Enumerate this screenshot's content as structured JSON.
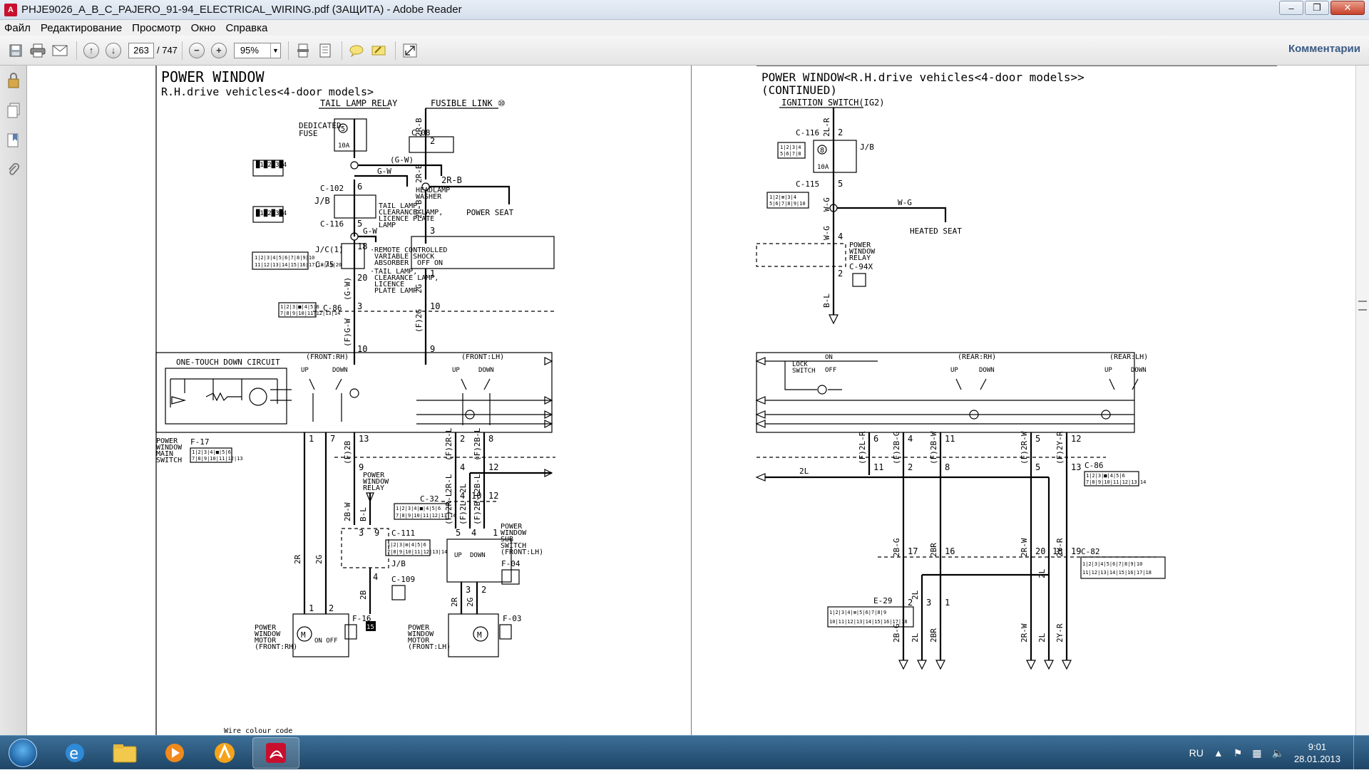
{
  "window": {
    "title": "PHJE9026_A_B_C_PAJERO_91-94_ELECTRICAL_WIRING.pdf (ЗАЩИТА) - Adobe Reader",
    "icon_label": "A",
    "minimize": "–",
    "maximize": "❐",
    "close": "✕"
  },
  "menu": [
    "Файл",
    "Редактирование",
    "Просмотр",
    "Окно",
    "Справка"
  ],
  "toolbar": {
    "page_current": "263",
    "page_total": "/ 747",
    "zoom": "95%",
    "comments_label": "Комментарии"
  },
  "left_page": {
    "title": "POWER WINDOW",
    "subtitle": "R.H.drive vehicles<4-door models>",
    "labels": {
      "tail_lamp_relay": "TAIL LAMP RELAY",
      "fusible_link": "FUSIBLE LINK ⑩",
      "dedicated_fuse_1": "DEDICATED",
      "dedicated_fuse_2": "FUSE",
      "fuse_num": "5",
      "fuse_amp": "10A",
      "c08": "C-08",
      "gw_paren": "(G-W)",
      "gw": "G-W",
      "headlamp_washer_1": "HEADLAMP",
      "headlamp_washer_2": "WASHER",
      "c102": "C-102",
      "jb": "J/B",
      "c116": "C-116",
      "tail_lamp_text_1": "TAIL LAMP,",
      "tail_lamp_text_2": "CLEARANCE LAMP,",
      "tail_lamp_text_3": "LICENCE PLATE",
      "tail_lamp_text_4": "LAMP",
      "power_seat": "POWER SEAT",
      "r2b": "2R-B",
      "jc1": "J/C(1)",
      "c75": "C-75",
      "remote_1": "·REMOTE CONTROLLED",
      "remote_2": "VARIABLE SHOCK",
      "remote_3": "ABSORBER",
      "remote_4": "·TAIL LAMP,",
      "remote_5": "CLEARANCE LAMP,",
      "remote_6": "LICENCE",
      "remote_7": "PLATE LAMP",
      "c86": "C-86",
      "off": "OFF",
      "on": "ON",
      "one_touch": "ONE-TOUCH DOWN CIRCUIT",
      "front_rh": "(FRONT:RH)",
      "front_lh": "(FRONT:LH)",
      "up": "UP",
      "down": "DOWN",
      "pw_main_switch_1": "POWER",
      "pw_main_switch_2": "WINDOW",
      "pw_main_switch_3": "MAIN",
      "pw_main_switch_4": "SWITCH",
      "f17": "F-17",
      "pw_relay_1": "POWER",
      "pw_relay_2": "WINDOW",
      "pw_relay_3": "RELAY",
      "c32": "C-32",
      "c111": "C-111",
      "c109": "C-109",
      "f04": "F-04",
      "sub_switch_1": "POWER",
      "sub_switch_2": "WINDOW",
      "sub_switch_3": "SUB",
      "sub_switch_4": "SWITCH",
      "sub_switch_5": "(FRONT:LH)",
      "f16": "F-16",
      "f03": "F-03",
      "motor_rh_1": "POWER",
      "motor_rh_2": "WINDOW",
      "motor_rh_3": "MOTOR",
      "motor_rh_4": "(FRONT:RH)",
      "motor_lh_1": "POWER",
      "motor_lh_2": "WINDOW",
      "motor_lh_3": "MOTOR",
      "motor_lh_4": "(FRONT:LH)",
      "wire_colour": "Wire colour code",
      "ground_15": "15"
    }
  },
  "right_page": {
    "title": "POWER WINDOW<R.H.drive vehicles<4-door models>>",
    "subtitle": "(CONTINUED)",
    "labels": {
      "ignition_switch": "IGNITION SWITCH(IG2)",
      "c116": "C-116",
      "jb": "J/B",
      "fuse_num": "8",
      "fuse_amp": "10A",
      "c115": "C-115",
      "wg": "W-G",
      "heated_seat": "HEATED SEAT",
      "pw_relay_1": "POWER",
      "pw_relay_2": "WINDOW",
      "pw_relay_3": "RELAY",
      "c94x": "C-94X",
      "lock_switch_1": "LOCK",
      "lock_switch_2": "SWITCH",
      "on": "ON",
      "off": "OFF",
      "rear_rh": "(REAR:RH)",
      "rear_lh": "(REAR:LH)",
      "up": "UP",
      "down": "DOWN",
      "c86": "C-86",
      "c82": "C-82",
      "e29": "E-29",
      "l2": "2L"
    }
  },
  "taskbar": {
    "lang": "RU",
    "time": "9:01",
    "date": "28.01.2013"
  },
  "colors": {
    "taskbar": "#1e4566",
    "pdf_red": "#c8102e",
    "comments": "#3b5a85"
  }
}
